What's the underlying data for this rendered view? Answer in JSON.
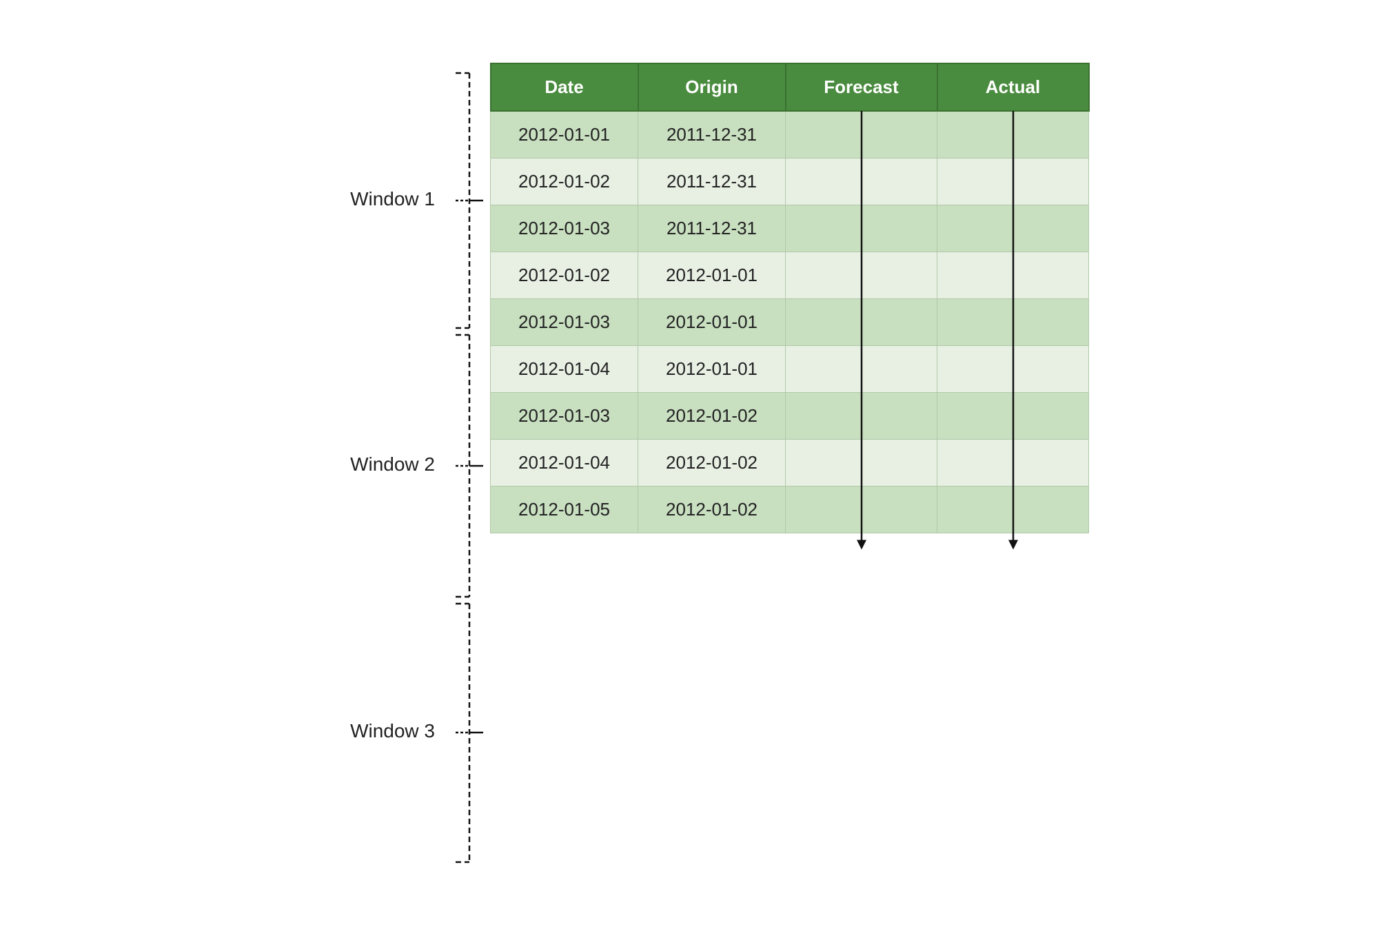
{
  "table": {
    "headers": [
      "Date",
      "Origin",
      "Forecast",
      "Actual"
    ],
    "rows": [
      {
        "date": "2012-01-01",
        "origin": "2011-12-31",
        "window": 1
      },
      {
        "date": "2012-01-02",
        "origin": "2011-12-31",
        "window": 1
      },
      {
        "date": "2012-01-03",
        "origin": "2011-12-31",
        "window": 1
      },
      {
        "date": "2012-01-02",
        "origin": "2012-01-01",
        "window": 2
      },
      {
        "date": "2012-01-03",
        "origin": "2012-01-01",
        "window": 2
      },
      {
        "date": "2012-01-04",
        "origin": "2012-01-01",
        "window": 2
      },
      {
        "date": "2012-01-03",
        "origin": "2012-01-02",
        "window": 3
      },
      {
        "date": "2012-01-04",
        "origin": "2012-01-02",
        "window": 3
      },
      {
        "date": "2012-01-05",
        "origin": "2012-01-02",
        "window": 3
      }
    ],
    "windows": [
      {
        "label": "Window 1",
        "rows": [
          0,
          1,
          2
        ]
      },
      {
        "label": "Window 2",
        "rows": [
          3,
          4,
          5
        ]
      },
      {
        "label": "Window 3",
        "rows": [
          6,
          7,
          8
        ]
      }
    ]
  },
  "colors": {
    "header_bg": "#4a8c3f",
    "header_text": "#ffffff",
    "row_odd": "#c8dfc0",
    "row_even": "#e8f0e4",
    "border": "#b0c8a8",
    "arrow": "#111111",
    "bracket": "#111111",
    "label_text": "#222222"
  }
}
